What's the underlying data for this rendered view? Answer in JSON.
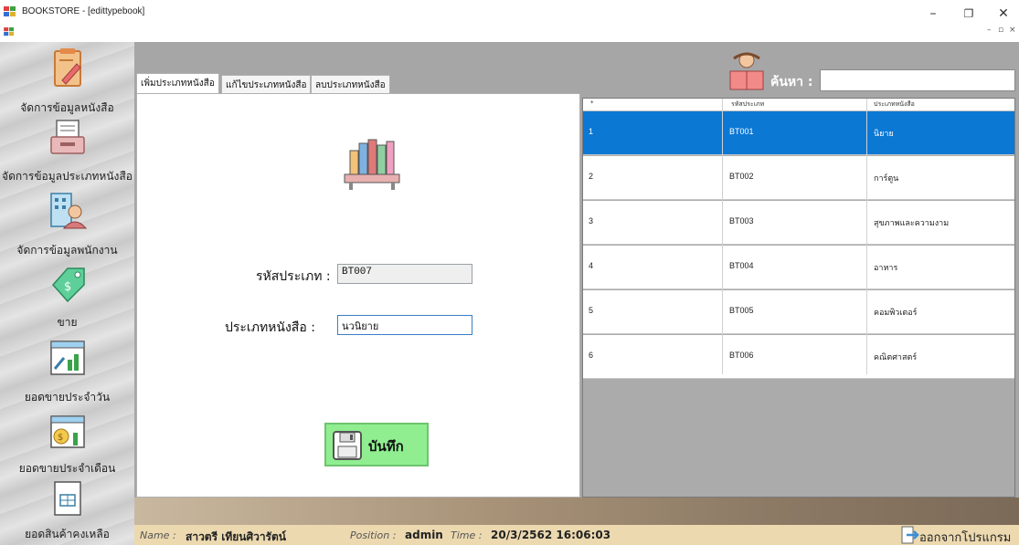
{
  "window": {
    "title": "BOOKSTORE - [edittypebook]",
    "minimize": "–",
    "restore": "❐",
    "close": "✕",
    "mdi_minimize": "–",
    "mdi_restore": "▫",
    "mdi_close": "×"
  },
  "sidebar": {
    "items": [
      {
        "label": "จัดการข้อมูลหนังสือ",
        "icon": "book-edit-icon"
      },
      {
        "label": "จัดการข้อมูลประเภทหนังสือ",
        "icon": "inbox-tray-icon"
      },
      {
        "label": "จัดการข้อมูลพนักงาน",
        "icon": "employee-building-icon"
      },
      {
        "label": "ขาย",
        "icon": "price-tag-icon"
      },
      {
        "label": "ยอดขายประจำวัน",
        "icon": "daily-chart-icon"
      },
      {
        "label": "ยอดขายประจำเดือน",
        "icon": "monthly-chart-icon"
      },
      {
        "label": "ยอดสินค้าคงเหลือ",
        "icon": "inventory-icon"
      }
    ]
  },
  "tabs": [
    {
      "label": "เพิ่มประเภทหนังสือ",
      "active": true
    },
    {
      "label": "แก้ไขประเภทหนังสือ",
      "active": false
    },
    {
      "label": "ลบประเภทหนังสือ",
      "active": false
    }
  ],
  "form": {
    "code_label": "รหัสประเภท :",
    "code_value": "BT007",
    "type_label": "ประเภทหนังสือ :",
    "type_value": "นวนิยาย",
    "save_label": "บันทึก"
  },
  "search": {
    "label": "ค้นหา :",
    "value": ""
  },
  "grid": {
    "columns": [
      "*",
      "รหัสประเภท",
      "ประเภทหนังสือ"
    ],
    "rows": [
      {
        "no": "1",
        "code": "BT001",
        "type": "นิยาย",
        "selected": true
      },
      {
        "no": "2",
        "code": "BT002",
        "type": "การ์ตูน",
        "selected": false
      },
      {
        "no": "3",
        "code": "BT003",
        "type": "สุขภาพและความงาม",
        "selected": false
      },
      {
        "no": "4",
        "code": "BT004",
        "type": "อาหาร",
        "selected": false
      },
      {
        "no": "5",
        "code": "BT005",
        "type": "คอมพิวเตอร์",
        "selected": false
      },
      {
        "no": "6",
        "code": "BT006",
        "type": "คณิตศาสตร์",
        "selected": false
      }
    ]
  },
  "status": {
    "name_key": "Name :",
    "name_value": "สาวตรี เทียนศิวารัตน์",
    "position_key": "Position :",
    "position_value": "admin",
    "time_key": "Time :",
    "time_value": "20/3/2562 16:06:03",
    "exit_label": "ออกจากโปรแกรม"
  },
  "colors": {
    "selected_row": "#0b78d4",
    "save_button": "#90ee90",
    "status_bar": "#ecd9b0",
    "mdi_background": "#a6a6a6"
  }
}
